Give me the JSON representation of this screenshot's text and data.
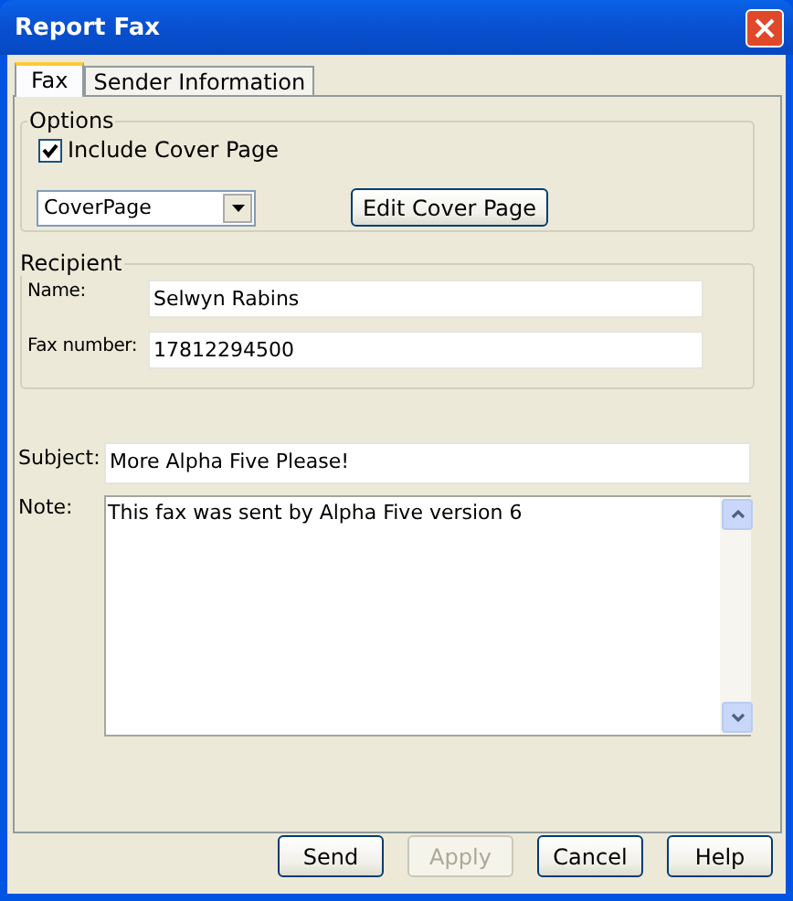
{
  "window": {
    "title": "Report Fax"
  },
  "tabs": [
    {
      "label": "Fax",
      "selected": true
    },
    {
      "label": "Sender Information",
      "selected": false
    }
  ],
  "options": {
    "title": "Options",
    "include_cover_page": {
      "label": "Include Cover Page",
      "checked": true
    },
    "cover_page_dropdown": {
      "value": "CoverPage"
    },
    "edit_button": "Edit Cover Page"
  },
  "recipient": {
    "title": "Recipient",
    "fields": [
      {
        "label": "Name:",
        "value": "Selwyn Rabins"
      },
      {
        "label": "Fax number:",
        "value": "17812294500"
      }
    ]
  },
  "subject": {
    "label": "Subject:",
    "value": "More Alpha Five Please!"
  },
  "note": {
    "label": "Note:",
    "value": "This fax was sent by Alpha Five version 6"
  },
  "buttons": [
    {
      "label": "Send",
      "disabled": false
    },
    {
      "label": "Apply",
      "disabled": true
    },
    {
      "label": "Cancel",
      "disabled": false
    },
    {
      "label": "Help",
      "disabled": false
    }
  ]
}
